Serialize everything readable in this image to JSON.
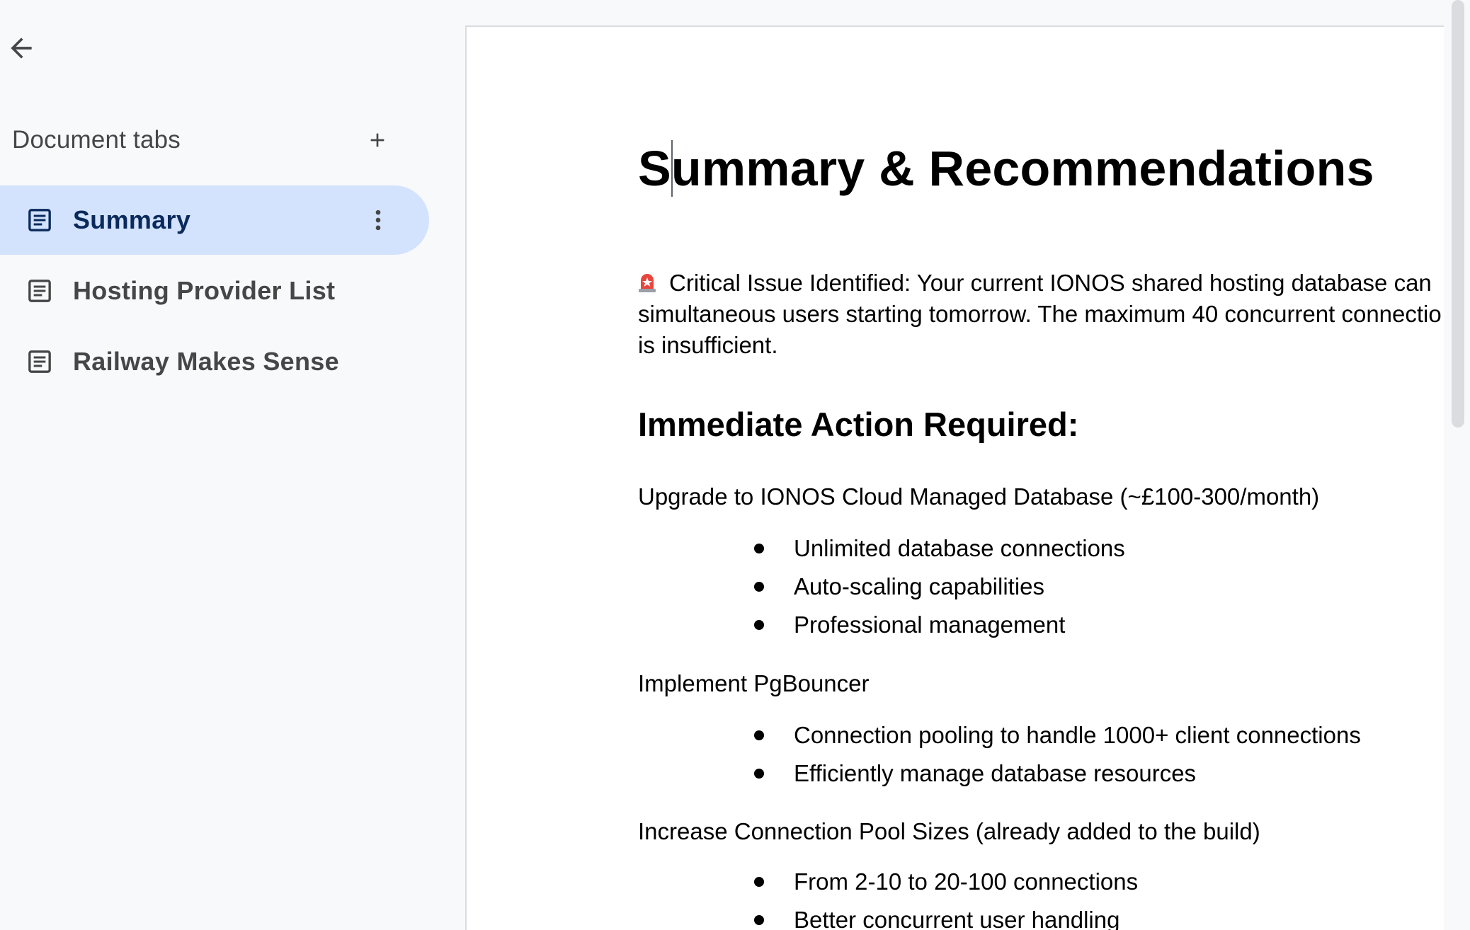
{
  "sidebar": {
    "back_label": "Back",
    "tabs_title": "Document tabs",
    "add_tab_label": "Add tab",
    "tabs": [
      {
        "label": "Summary",
        "active": true
      },
      {
        "label": "Hosting Provider List",
        "active": false
      },
      {
        "label": "Railway Makes Sense",
        "active": false
      }
    ]
  },
  "document": {
    "title": "Summary & Recommendations",
    "alert_icon": "rotating-light-icon",
    "alert_text_1": "Critical Issue Identified: Your current IONOS shared hosting database can",
    "alert_text_2": "simultaneous users starting tomorrow. The maximum 40 concurrent connectio",
    "alert_text_3": "is insufficient.",
    "heading": "Immediate Action Required:",
    "sections": [
      {
        "title": "Upgrade to IONOS Cloud Managed Database (~£100-300/month)",
        "bullets": [
          "Unlimited database connections",
          "Auto-scaling capabilities",
          "Professional management"
        ]
      },
      {
        "title": "Implement PgBouncer",
        "bullets": [
          "Connection pooling to handle 1000+ client connections",
          "Efficiently manage database resources"
        ]
      },
      {
        "title": "Increase Connection Pool Sizes (already added to the build)",
        "bullets": [
          "From 2-10 to 20-100 connections",
          "Better concurrent user handling"
        ]
      }
    ]
  },
  "colors": {
    "background": "#f8f9fb",
    "active_tab": "#d3e3fd",
    "active_tab_text": "#0b2a5c",
    "inactive_text": "#444746",
    "alert_red": "#e8453c"
  }
}
